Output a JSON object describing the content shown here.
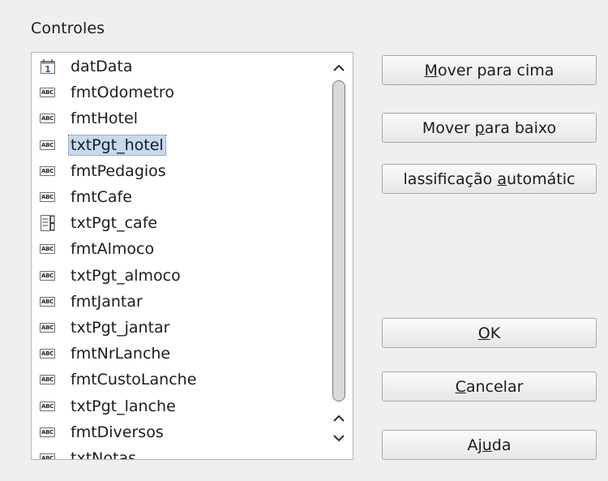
{
  "group": {
    "label": "Controles",
    "mnemonic_index": 2
  },
  "list_items": [
    {
      "icon": "date-field-icon",
      "label": "datData",
      "selected": false
    },
    {
      "icon": "formatted-field-icon",
      "label": "fmtOdometro",
      "selected": false
    },
    {
      "icon": "formatted-field-icon",
      "label": "fmtHotel",
      "selected": false
    },
    {
      "icon": "formatted-field-icon",
      "label": "txtPgt_hotel",
      "selected": true
    },
    {
      "icon": "formatted-field-icon",
      "label": "fmtPedagios",
      "selected": false
    },
    {
      "icon": "formatted-field-icon",
      "label": "fmtCafe",
      "selected": false
    },
    {
      "icon": "numeric-field-icon",
      "label": "txtPgt_cafe",
      "selected": false
    },
    {
      "icon": "formatted-field-icon",
      "label": "fmtAlmoco",
      "selected": false
    },
    {
      "icon": "formatted-field-icon",
      "label": "txtPgt_almoco",
      "selected": false
    },
    {
      "icon": "formatted-field-icon",
      "label": "fmtJantar",
      "selected": false
    },
    {
      "icon": "formatted-field-icon",
      "label": "txtPgt_jantar",
      "selected": false
    },
    {
      "icon": "formatted-field-icon",
      "label": "fmtNrLanche",
      "selected": false
    },
    {
      "icon": "formatted-field-icon",
      "label": "fmtCustoLanche",
      "selected": false
    },
    {
      "icon": "formatted-field-icon",
      "label": "txtPgt_lanche",
      "selected": false
    },
    {
      "icon": "formatted-field-icon",
      "label": "fmtDiversos",
      "selected": false
    },
    {
      "icon": "formatted-field-icon",
      "label": "txtNotas",
      "selected": false
    }
  ],
  "icon_text": {
    "abc": "ABC",
    "date": "1"
  },
  "scrollbar": {
    "up_icon": "chevron-up-icon",
    "down_icon": "chevron-down-icon",
    "position_fraction": 0.0
  },
  "buttons": {
    "move_up": {
      "label": "Mover para cima",
      "mnemonic": "M"
    },
    "move_down": {
      "label": "Mover para baixo",
      "mnemonic": "p"
    },
    "auto_sort": {
      "label": "lassificação automátic",
      "mnemonic": "a"
    },
    "ok": {
      "label": "OK",
      "mnemonic": "O"
    },
    "cancel": {
      "label": "Cancelar",
      "mnemonic": "C"
    },
    "help": {
      "label": "Ajuda",
      "mnemonic": "u"
    }
  },
  "colors": {
    "selection": "#c5d9ef",
    "background": "#efefef"
  }
}
